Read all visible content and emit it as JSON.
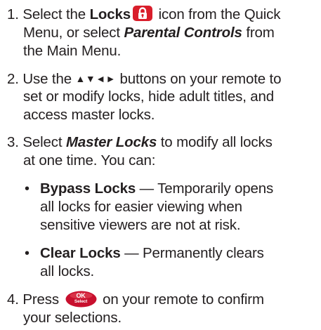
{
  "steps": [
    {
      "number": "1.",
      "l1_pre": "Select the ",
      "l1_bold": "Locks",
      "l1_post": " icon from the Quick",
      "l2_pre": "Menu, or select ",
      "l2_bi": "Parental Controls",
      "l2_post": " from",
      "l3": "the Main Menu."
    },
    {
      "number": "2.",
      "l1_pre": "Use the ",
      "l1_arrows": "▲▼◄►",
      "l1_post": " buttons on your remote to",
      "l2": "set or modify locks, hide adult titles, and",
      "l3": "access master locks."
    },
    {
      "number": "3.",
      "l1_pre": "Select ",
      "l1_bi": "Master Locks",
      "l1_post": " to modify all locks",
      "l2": "at one time. You can:"
    },
    {
      "number": "4.",
      "l1_pre": "Press ",
      "l1_post": " on your remote to confirm",
      "l2": "your selections."
    }
  ],
  "options": [
    {
      "bullet": "•",
      "term": "Bypass Locks",
      "l1_post": " — Temporarily opens",
      "l2": "all locks for easier viewing when",
      "l3": "sensitive viewers are not at risk."
    },
    {
      "bullet": "•",
      "term": "Clear Locks",
      "l1_post": " — Permanently clears",
      "l2": "all locks."
    }
  ],
  "ok_button": {
    "top": "OK",
    "bottom": "Select"
  },
  "colors": {
    "text": "#231f20",
    "lock_icon": "#d91e2b",
    "ok_button": "#c8102e"
  },
  "icons": {
    "lock": "lock-icon",
    "ok": "ok-select-button"
  }
}
